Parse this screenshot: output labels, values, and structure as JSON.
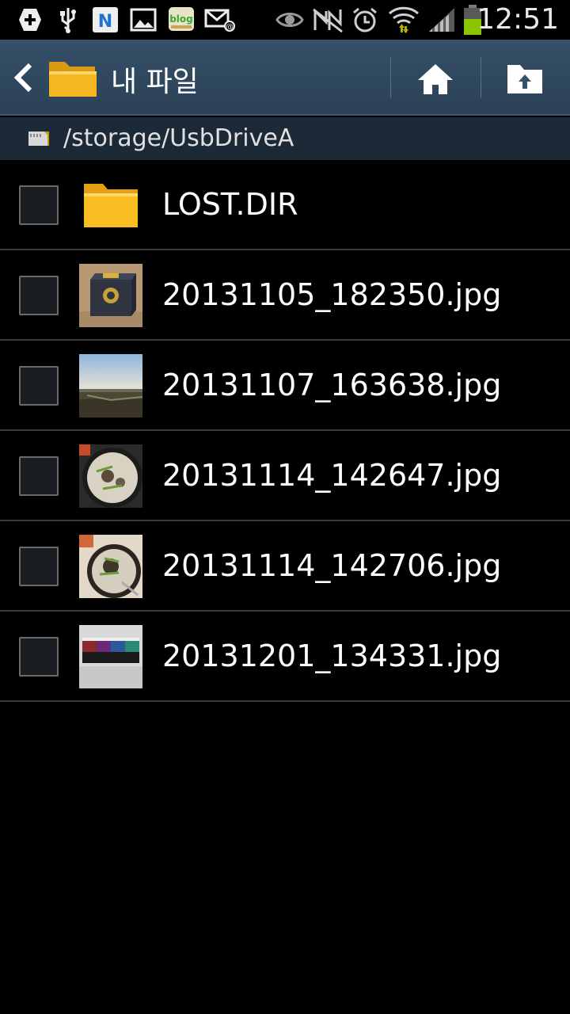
{
  "status_bar": {
    "time": "12:51",
    "icons": [
      "add-icon",
      "usb-icon",
      "n-app-icon",
      "gallery-icon",
      "blog-icon",
      "mail-icon",
      "eye-icon",
      "nfc-mute-icon",
      "alarm-icon",
      "wifi-icon",
      "signal-icon",
      "battery-icon"
    ],
    "n_app_label": "N",
    "blog_label": "blog"
  },
  "action_bar": {
    "title": "내 파일",
    "back_icon": "chevron-left-icon",
    "app_icon": "folder-icon",
    "home_icon": "home-icon",
    "up_icon": "folder-up-icon"
  },
  "path_bar": {
    "path": "/storage/UsbDriveA",
    "icon": "sd-card-icon"
  },
  "files": [
    {
      "name": "LOST.DIR",
      "type": "folder"
    },
    {
      "name": "20131105_182350.jpg",
      "type": "image"
    },
    {
      "name": "20131107_163638.jpg",
      "type": "image"
    },
    {
      "name": "20131114_142647.jpg",
      "type": "image"
    },
    {
      "name": "20131114_142706.jpg",
      "type": "image"
    },
    {
      "name": "20131201_134331.jpg",
      "type": "image"
    }
  ],
  "colors": {
    "action_bar": "#355068",
    "path_bar": "#1c2a37",
    "folder": "#f2b21d",
    "battery": "#8bc400"
  }
}
